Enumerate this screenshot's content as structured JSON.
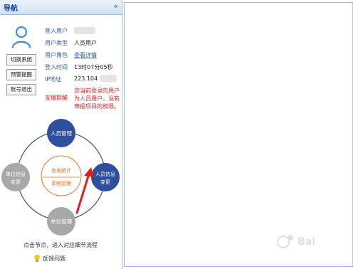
{
  "nav": {
    "title": "导航",
    "collapse_icon": "«"
  },
  "side_buttons": [
    {
      "label": "切换系统"
    },
    {
      "label": "预警提醒"
    },
    {
      "label": "账号退出"
    }
  ],
  "user_info": {
    "login_user_label": "登入用户",
    "user_type_label": "用户类型",
    "user_type_value": "人员用户",
    "user_role_label": "用户角色",
    "user_role_link": "查看详情",
    "login_time_label": "登入时间",
    "login_time_value": "13时07分05秒",
    "ip_label": "IP地址",
    "ip_value": "223.104",
    "reminder_label": "友情提醒",
    "reminder_text": "您当前登录的用户为人员用户，没有申报项目的权限。"
  },
  "diagram": {
    "top_node": "人员管理",
    "right_node_line1": "人员信息",
    "right_node_line2": "变更",
    "bottom_node": "单位管理",
    "left_node_line1": "单位信息",
    "left_node_line2": "变更",
    "center_top": "查询统计",
    "center_bottom": "系统管理"
  },
  "hint": "点击节点，进入对应细节流程",
  "feedback": "反馈问题",
  "colors": {
    "header_text": "#15428b",
    "label_blue": "#2b5aa8",
    "node_blue": "#2e4f9e",
    "node_gray": "#a8a8a8",
    "center_orange": "#e8731a",
    "warning_red": "#dd2222"
  }
}
